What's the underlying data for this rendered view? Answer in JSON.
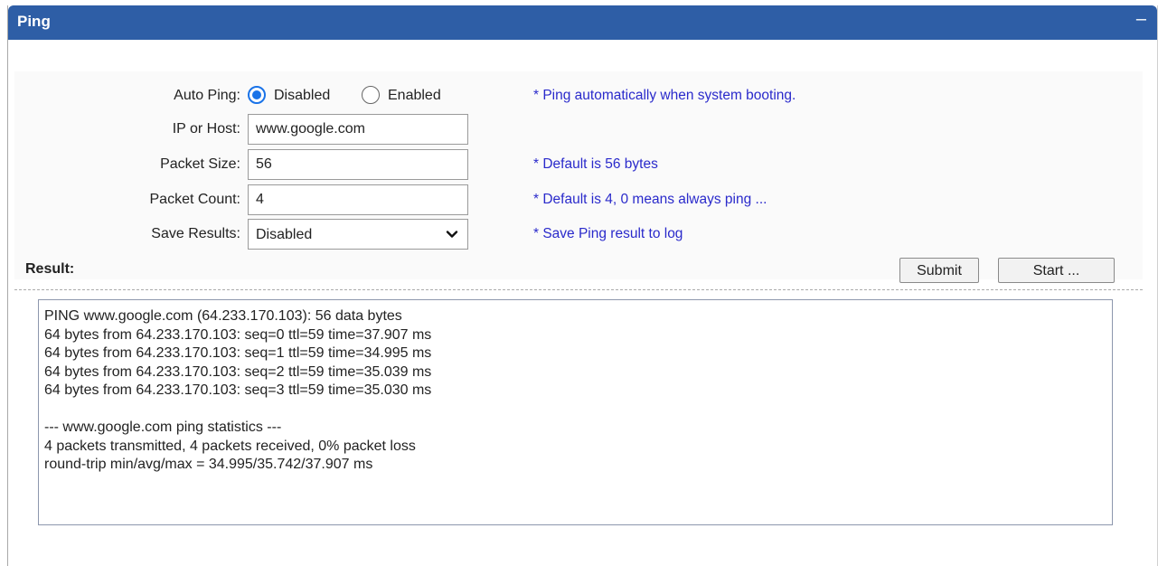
{
  "header": {
    "title": "Ping",
    "minimize_glyph": "–"
  },
  "form": {
    "auto_ping": {
      "label": "Auto Ping:",
      "options": [
        "Disabled",
        "Enabled"
      ],
      "selected": "Disabled",
      "hint": "* Ping automatically when system booting."
    },
    "host": {
      "label": "IP or Host:",
      "value": "www.google.com"
    },
    "packet_size": {
      "label": "Packet Size:",
      "value": "56",
      "hint": "* Default is 56 bytes"
    },
    "packet_count": {
      "label": "Packet Count:",
      "value": "4",
      "hint": "* Default is 4, 0 means always ping ..."
    },
    "save_results": {
      "label": "Save Results:",
      "value": "Disabled",
      "hint": "* Save Ping result to log"
    }
  },
  "result": {
    "label": "Result:",
    "submit_label": "Submit",
    "start_label": "Start ...",
    "lines": [
      "PING www.google.com (64.233.170.103): 56 data bytes",
      "64 bytes from 64.233.170.103: seq=0 ttl=59 time=37.907 ms",
      "64 bytes from 64.233.170.103: seq=1 ttl=59 time=34.995 ms",
      "64 bytes from 64.233.170.103: seq=2 ttl=59 time=35.039 ms",
      "64 bytes from 64.233.170.103: seq=3 ttl=59 time=35.030 ms",
      "",
      "--- www.google.com ping statistics ---",
      "4 packets transmitted, 4 packets received, 0% packet loss",
      "round-trip min/avg/max = 34.995/35.742/37.907 ms"
    ]
  },
  "colors": {
    "header_bg": "#2e5ea6",
    "hint_text": "#2a2acb",
    "radio_accent": "#1a73e8"
  }
}
